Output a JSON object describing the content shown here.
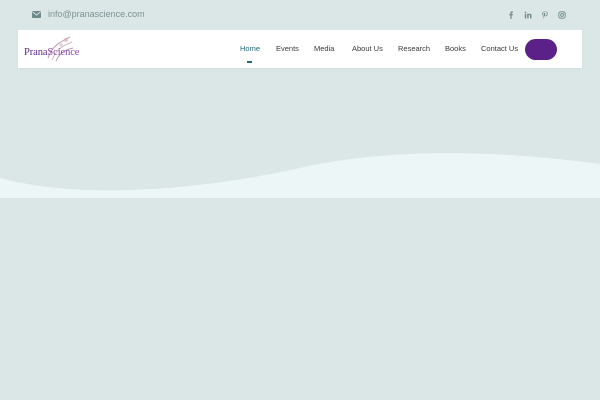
{
  "topbar": {
    "email": "info@pranascience.com",
    "icons": {
      "email": "envelope-icon"
    },
    "socials": [
      {
        "name": "facebook-icon",
        "glyph": "f"
      },
      {
        "name": "linkedin-icon",
        "glyph": "in"
      },
      {
        "name": "pinterest-icon",
        "glyph": "P"
      },
      {
        "name": "instagram-icon",
        "glyph": "ig"
      }
    ]
  },
  "logo": {
    "part1": "Prana",
    "part2": "Science"
  },
  "nav": {
    "items": [
      {
        "label": "Home",
        "active": true
      },
      {
        "label": "Events"
      },
      {
        "label": "Media"
      },
      {
        "label": "About Us"
      },
      {
        "label": "Research"
      },
      {
        "label": "Books"
      },
      {
        "label": "Contact Us"
      }
    ],
    "cta_label": ""
  },
  "colors": {
    "page_bg": "#dbe6e6",
    "wave": "#edf6f7",
    "accent": "#5b2188",
    "nav_active": "#1f6a7a"
  }
}
